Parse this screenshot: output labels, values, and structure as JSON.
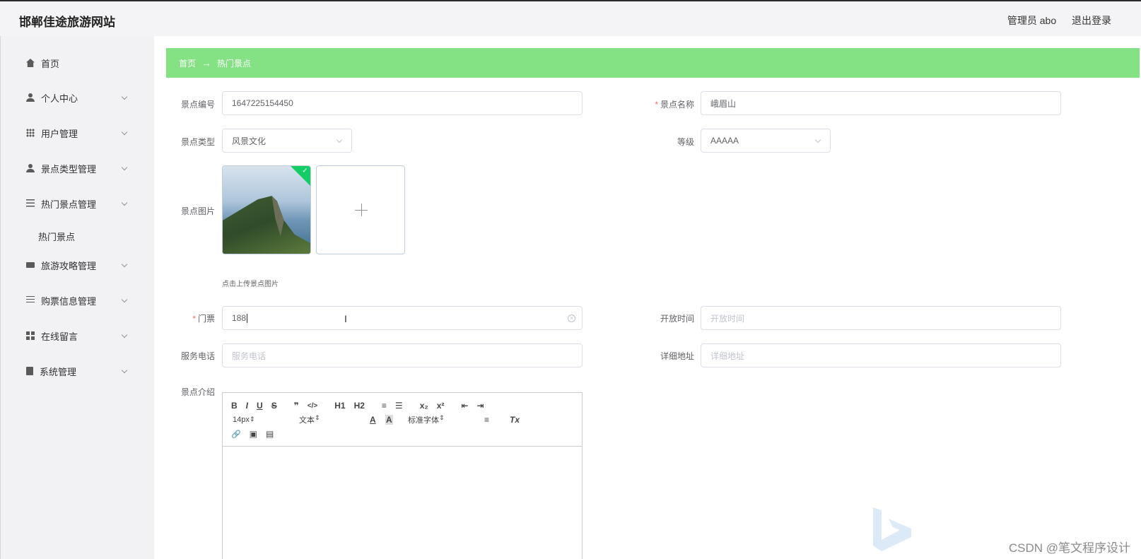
{
  "app": {
    "title": "邯郸佳途旅游网站",
    "user_label": "管理员 abo",
    "logout_label": "退出登录"
  },
  "sidebar": {
    "items": [
      {
        "label": "首页",
        "icon": "home-icon"
      },
      {
        "label": "个人中心",
        "icon": "user-icon"
      },
      {
        "label": "用户管理",
        "icon": "grid-icon"
      },
      {
        "label": "景点类型管理",
        "icon": "user-icon"
      },
      {
        "label": "热门景点管理",
        "icon": "list-icon"
      },
      {
        "label": "旅游攻略管理",
        "icon": "monitor-icon"
      },
      {
        "label": "购票信息管理",
        "icon": "sliders-icon"
      },
      {
        "label": "在线留言",
        "icon": "apps-icon"
      },
      {
        "label": "系统管理",
        "icon": "document-icon"
      }
    ],
    "sub_item": "热门景点"
  },
  "breadcrumb": {
    "home": "首页",
    "separator": "→",
    "current": "热门景点",
    "bg_color": "#84e184"
  },
  "form": {
    "spot_id": {
      "label": "景点编号",
      "value": "1647225154450"
    },
    "spot_name": {
      "label": "景点名称",
      "value": "峨眉山",
      "required_mark": "*"
    },
    "spot_type": {
      "label": "景点类型",
      "value": "风景文化"
    },
    "grade": {
      "label": "等级",
      "value": "AAAAA"
    },
    "picture": {
      "label": "景点图片",
      "tip": "点击上传景点图片",
      "success_mark": "✓"
    },
    "ticket": {
      "label": "门票",
      "value": "188",
      "required_mark": "*"
    },
    "open_time": {
      "label": "开放时间",
      "placeholder": "开放时间"
    },
    "service_phone": {
      "label": "服务电话",
      "placeholder": "服务电话"
    },
    "address": {
      "label": "详细地址",
      "placeholder": "详细地址"
    },
    "intro": {
      "label": "景点介绍"
    }
  },
  "editor": {
    "row1": [
      "B",
      "I",
      "U",
      "S",
      "❞",
      "</>",
      "H1",
      "H2",
      "≡",
      "☰",
      "x₂",
      "x²",
      "⇤",
      "⇥"
    ],
    "font_size": "14px",
    "header_select": "文本",
    "font_family": "标准字体",
    "font_color": "A",
    "bg_color_btn": "A",
    "align": "≡",
    "clean": "Tx",
    "row3": [
      "🔗",
      "▣",
      "▤"
    ]
  },
  "watermark": "CSDN @笔文程序设计"
}
